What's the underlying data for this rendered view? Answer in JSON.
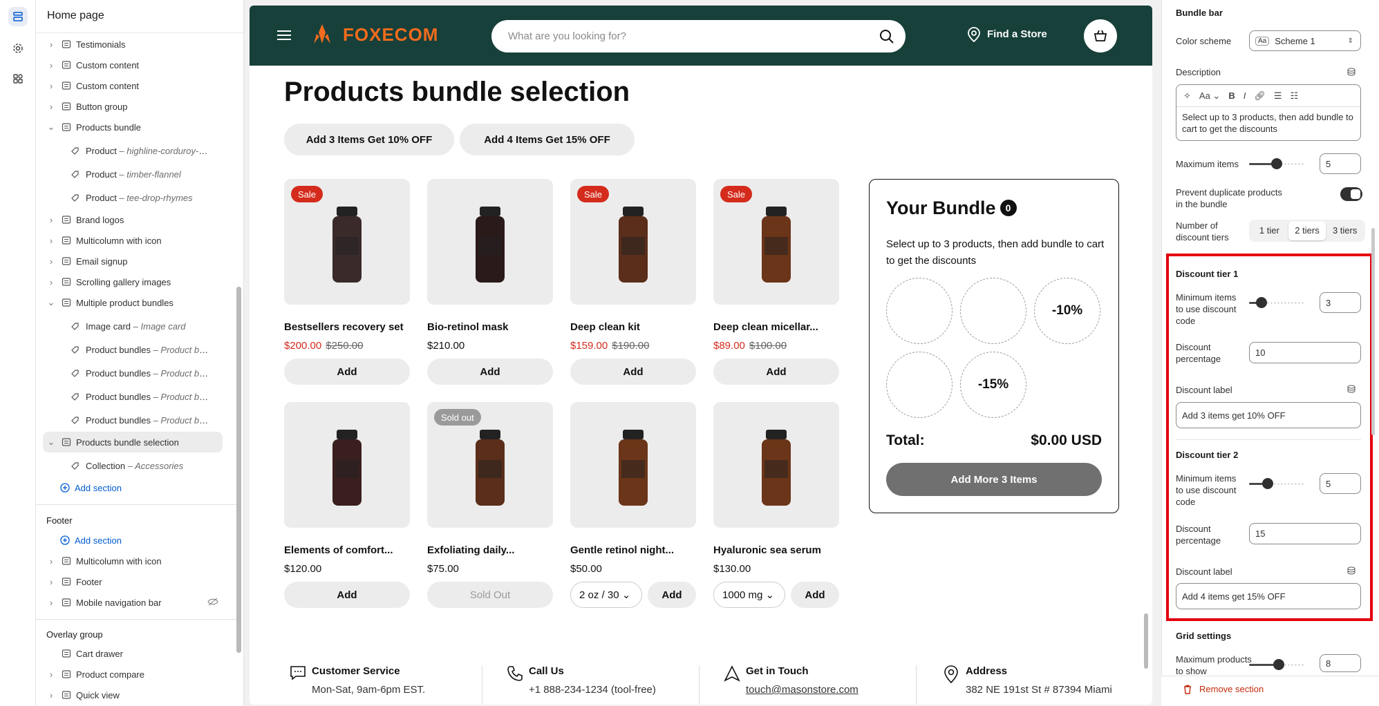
{
  "sidebar": {
    "title": "Home page",
    "items": [
      {
        "label": "Testimonials",
        "sub": ""
      },
      {
        "label": "Custom content",
        "sub": ""
      },
      {
        "label": "Custom content",
        "sub": ""
      },
      {
        "label": "Button group",
        "sub": ""
      },
      {
        "label": "Products bundle",
        "sub": ""
      },
      {
        "label": "Product",
        "sub": "highline-corduroy-pant"
      },
      {
        "label": "Product",
        "sub": "timber-flannel"
      },
      {
        "label": "Product",
        "sub": "tee-drop-rhymes"
      },
      {
        "label": "Brand logos",
        "sub": ""
      },
      {
        "label": "Multicolumn with icon",
        "sub": ""
      },
      {
        "label": "Email signup",
        "sub": ""
      },
      {
        "label": "Scrolling gallery images",
        "sub": ""
      },
      {
        "label": "Multiple product bundles",
        "sub": ""
      },
      {
        "label": "Image card",
        "sub": "Image card"
      },
      {
        "label": "Product bundles",
        "sub": "Product bundl..."
      },
      {
        "label": "Product bundles",
        "sub": "Product bundl..."
      },
      {
        "label": "Product bundles",
        "sub": "Product bundl..."
      },
      {
        "label": "Product bundles",
        "sub": "Product bundl..."
      },
      {
        "label": "Products bundle selection",
        "sub": ""
      },
      {
        "label": "Collection",
        "sub": "Accessories"
      }
    ],
    "add_section": "Add section",
    "footer_title": "Footer",
    "footer_add_section": "Add section",
    "footer_items": [
      "Multicolumn with icon",
      "Footer",
      "Mobile navigation bar"
    ],
    "overlay_title": "Overlay group",
    "overlay_items": [
      "Cart drawer",
      "Product compare",
      "Quick view"
    ],
    "dash": "–"
  },
  "store": {
    "logo_text": "FOXECOM",
    "search_placeholder": "What are you looking for?",
    "find_store": "Find a Store",
    "brand_orange": "#f26b1d",
    "header_bg": "#17403a"
  },
  "section": {
    "title": "Products bundle selection",
    "pills": [
      "Add 3 Items Get 10% OFF",
      "Add 4 Items Get 15% OFF"
    ]
  },
  "products": [
    {
      "name": "Bestsellers recovery set",
      "price": "$200.00",
      "compare": "$250.00",
      "badge": "Sale",
      "button": "Add",
      "variant": ""
    },
    {
      "name": "Bio-retinol mask",
      "price": "$210.00",
      "compare": "",
      "badge": "",
      "button": "Add",
      "variant": ""
    },
    {
      "name": "Deep clean kit",
      "price": "$159.00",
      "compare": "$190.00",
      "badge": "Sale",
      "button": "Add",
      "variant": ""
    },
    {
      "name": "Deep clean micellar...",
      "price": "$89.00",
      "compare": "$100.00",
      "badge": "Sale",
      "button": "Add",
      "variant": ""
    },
    {
      "name": "Elements of comfort...",
      "price": "$120.00",
      "compare": "",
      "badge": "",
      "button": "Add",
      "variant": ""
    },
    {
      "name": "Exfoliating daily...",
      "price": "$75.00",
      "compare": "",
      "badge": "Sold out",
      "button": "Sold Out",
      "variant": ""
    },
    {
      "name": "Gentle retinol night...",
      "price": "$50.00",
      "compare": "",
      "badge": "",
      "button": "Add",
      "variant": "2 oz / 30"
    },
    {
      "name": "Hyaluronic sea serum",
      "price": "$130.00",
      "compare": "",
      "badge": "",
      "button": "Add",
      "variant": "1000 mg"
    }
  ],
  "bundle": {
    "title": "Your Bundle",
    "count": "0",
    "description": "Select up to 3 products, then add bundle to cart to get the discounts",
    "slot_labels": [
      "",
      "",
      "-10%",
      "",
      "-15%"
    ],
    "total_label": "Total:",
    "total_value": "$0.00 USD",
    "button": "Add More 3 Items"
  },
  "footer_info": [
    {
      "title": "Customer Service",
      "text": "Mon-Sat, 9am-6pm EST."
    },
    {
      "title": "Call Us",
      "text": "+1 888-234-1234 (tool-free)"
    },
    {
      "title": "Get in Touch",
      "text": "touch@masonstore.com"
    },
    {
      "title": "Address",
      "text": "382 NE 191st St # 87394 Miami"
    }
  ],
  "settings": {
    "heading": "Bundle bar",
    "color_scheme_label": "Color scheme",
    "color_scheme_value": "Scheme 1",
    "color_scheme_icon": "Aa",
    "description_label": "Description",
    "description_text": "Select up to 3 products, then add bundle to cart to get the discounts",
    "rte_aa": "Aa",
    "max_items_label": "Maximum items",
    "max_items_value": "5",
    "max_items_level": 0.5,
    "prevent_dup_label": "Prevent duplicate products in the bundle",
    "prevent_dup_on": true,
    "tiers_label": "Number of discount tiers",
    "tiers_options": [
      "1 tier",
      "2 tiers",
      "3 tiers"
    ],
    "tiers_selected": "2 tiers",
    "tier1": {
      "heading": "Discount tier 1",
      "min_label": "Minimum items to use discount code",
      "min_value": "3",
      "min_level": 0.15,
      "pct_label": "Discount percentage",
      "pct_value": "10",
      "label_label": "Discount label",
      "label_value": "Add 3 items get 10% OFF"
    },
    "tier2": {
      "heading": "Discount tier 2",
      "min_label": "Minimum items to use discount code",
      "min_value": "5",
      "min_level": 0.3,
      "pct_label": "Discount percentage",
      "pct_value": "15",
      "label_label": "Discount label",
      "label_value": "Add 4 items get 15% OFF"
    },
    "grid_heading": "Grid settings",
    "max_products_label": "Maximum products to show",
    "max_products_value": "8",
    "max_products_level": 0.55,
    "remove_label": "Remove section"
  }
}
